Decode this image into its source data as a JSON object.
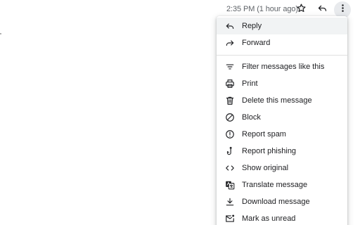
{
  "header": {
    "timestamp": "2:35 PM (1 hour ago)",
    "star_icon": "star-outline-icon",
    "reply_icon": "reply-icon",
    "more_icon": "more-vert-icon"
  },
  "menu": {
    "group1": [
      {
        "label": "Reply",
        "icon": "reply-icon"
      },
      {
        "label": "Forward",
        "icon": "forward-icon"
      }
    ],
    "group2": [
      {
        "label": "Filter messages like this",
        "icon": "filter-icon"
      },
      {
        "label": "Print",
        "icon": "print-icon"
      },
      {
        "label": "Delete this message",
        "icon": "trash-icon"
      },
      {
        "label": "Block",
        "icon": "block-icon"
      },
      {
        "label": "Report spam",
        "icon": "report-spam-icon"
      },
      {
        "label": "Report phishing",
        "icon": "phishing-hook-icon"
      },
      {
        "label": "Show original",
        "icon": "code-icon"
      },
      {
        "label": "Translate message",
        "icon": "translate-icon"
      },
      {
        "label": "Download message",
        "icon": "download-icon"
      },
      {
        "label": "Mark as unread",
        "icon": "mark-unread-icon"
      }
    ]
  },
  "colors": {
    "text": "#202124",
    "secondary_text": "#5f6368",
    "hover_bg": "#f1f3f4",
    "active_button_bg": "#e8eaed"
  }
}
